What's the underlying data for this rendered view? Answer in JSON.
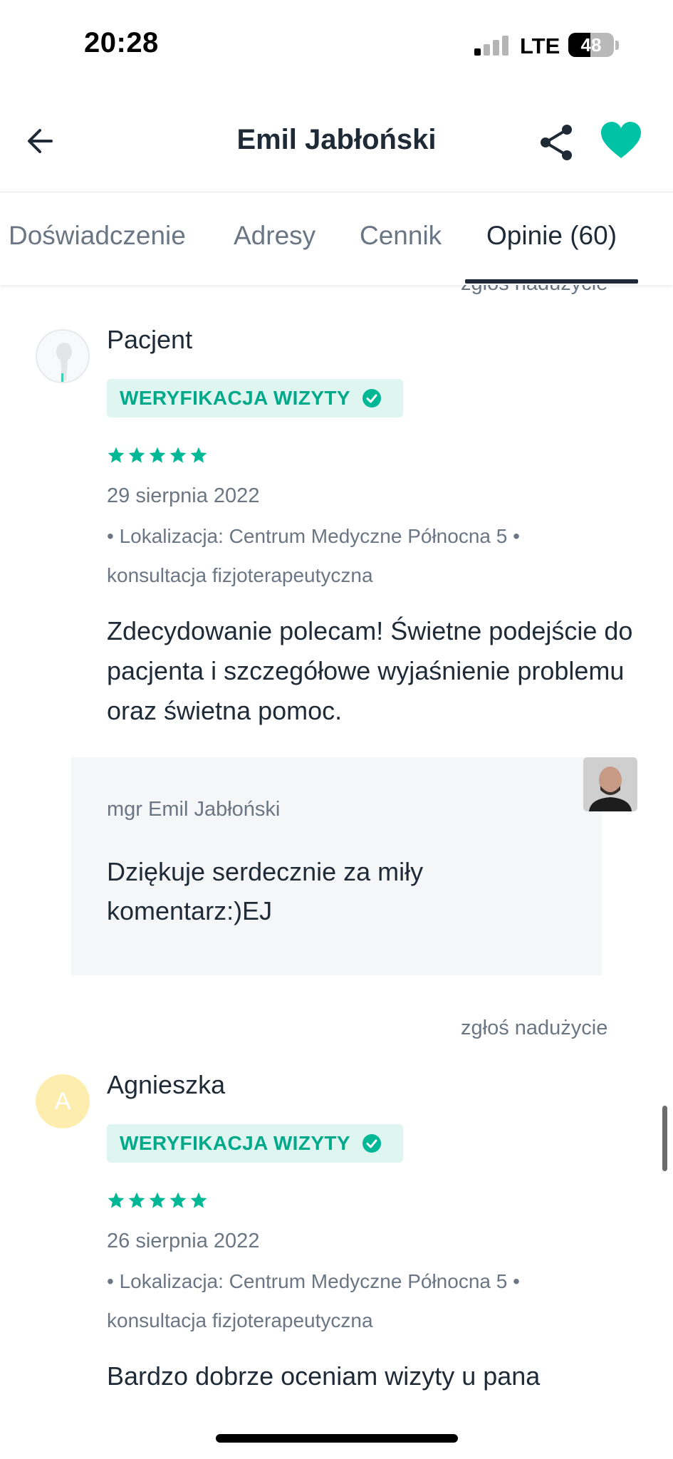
{
  "status_bar": {
    "time": "20:28",
    "network": "LTE",
    "battery": "48",
    "battery_level": 0.48
  },
  "header": {
    "title": "Emil Jabłoński",
    "back_icon": "arrow-left-icon",
    "share_icon": "share-icon",
    "favorite_icon": "heart-icon",
    "accent_color": "#00c3a5"
  },
  "tabs": [
    {
      "label": "Doświadczenie"
    },
    {
      "label": "Adresy"
    },
    {
      "label": "Cennik"
    },
    {
      "label": "Opinie (60)",
      "active": true
    }
  ],
  "reviews": [
    {
      "top_report": "zgłoś nadużycie",
      "author": "Pacjent",
      "badge": "WERYFIKACJA WIZYTY",
      "rating": 5,
      "date": "29 sierpnia 2022",
      "meta_line1": "• Lokalizacja: Centrum Medyczne Północna 5 •",
      "meta_line2": "konsultacja fizjoterapeutyczna",
      "text": "Zdecydowanie polecam! Świetne podejście do pacjenta i szczegółowe wyjaśnienie problemu oraz świetna pomoc.",
      "reply": {
        "author": "mgr Emil Jabłoński",
        "text": "Dziękuje serdecznie za miły komentarz:)EJ"
      }
    },
    {
      "report": "zgłoś nadużycie",
      "avatar_letter": "A",
      "author": "Agnieszka",
      "badge": "WERYFIKACJA WIZYTY",
      "rating": 5,
      "date": "26 sierpnia 2022",
      "meta_line1": "• Lokalizacja: Centrum Medyczne Północna 5 •",
      "meta_line2": "konsultacja fizjoterapeutyczna",
      "text": "Bardzo dobrze oceniam wizyty u pana"
    }
  ]
}
